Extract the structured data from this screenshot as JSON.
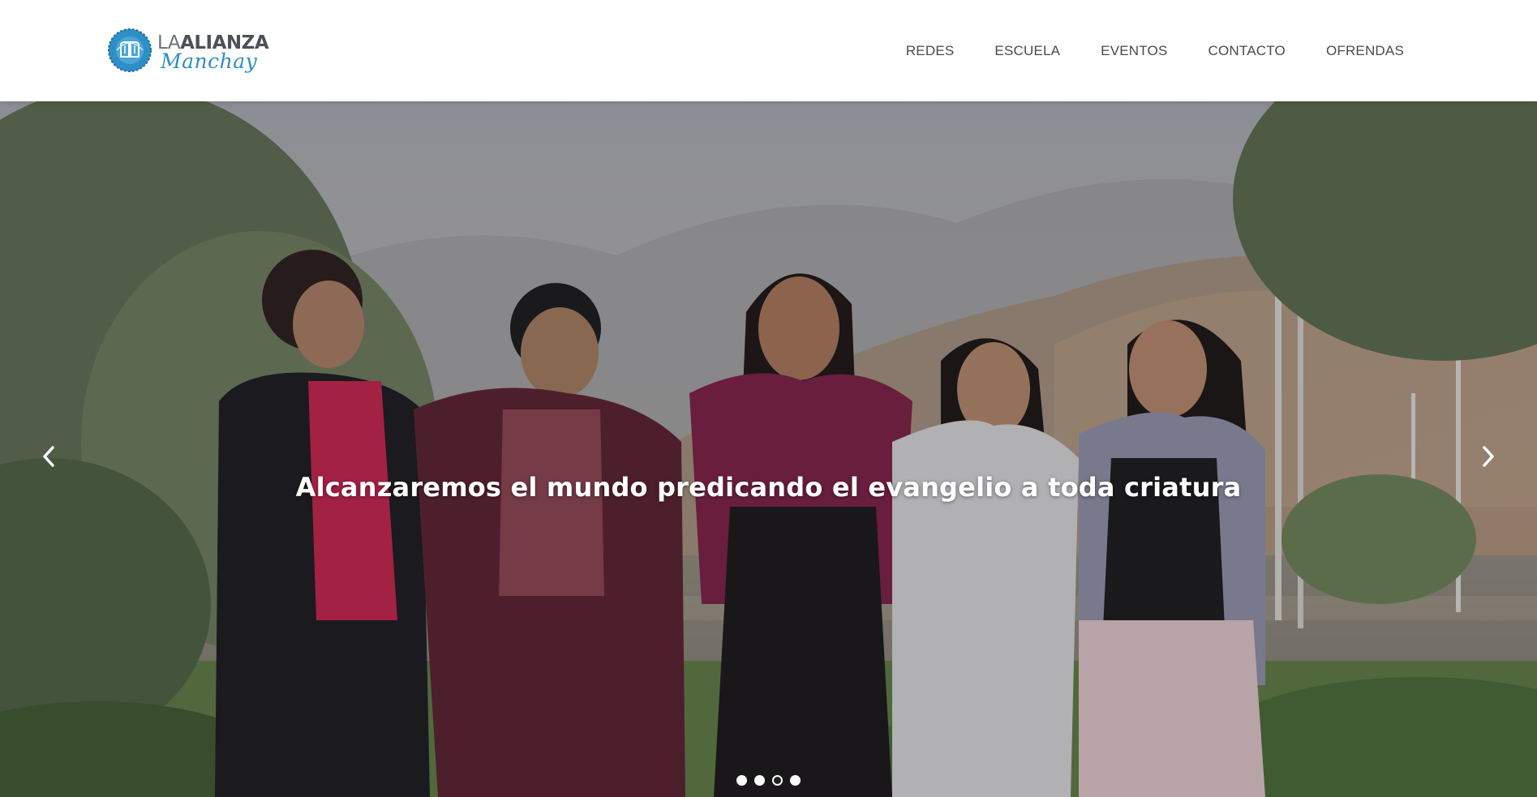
{
  "brand": {
    "name_prefix": "LA",
    "name_main": "ALIANZA",
    "name_script": "Manchay",
    "logo_color": "#2f8ec6"
  },
  "nav": {
    "items": [
      {
        "label": "REDES"
      },
      {
        "label": "ESCUELA"
      },
      {
        "label": "EVENTOS"
      },
      {
        "label": "CONTACTO"
      },
      {
        "label": "OFRENDAS"
      }
    ]
  },
  "hero": {
    "caption": "Alcanzaremos el mundo predicando el evangelio a toda criatura",
    "prev_icon": "chevron-left-icon",
    "next_icon": "chevron-right-icon",
    "slide_count": 4,
    "active_slide": 3
  }
}
